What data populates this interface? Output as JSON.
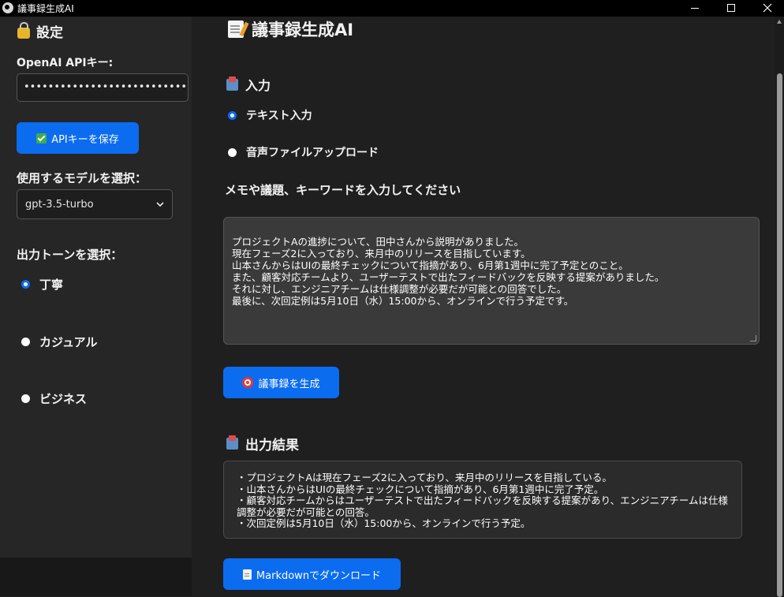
{
  "window": {
    "title": "議事録生成AI"
  },
  "sidebar": {
    "heading": "設定",
    "api_key_label": "OpenAI APIキー:",
    "api_key_value": "••••••••••••••••••••••••••••••••••••••••••••••••••",
    "save_button": "APIキーを保存",
    "model_label": "使用するモデルを選択：",
    "model_selected": "gpt-3.5-turbo",
    "tone_label": "出力トーンを選択：",
    "tone_options": [
      {
        "label": "丁寧",
        "selected": true
      },
      {
        "label": "カジュアル",
        "selected": false
      },
      {
        "label": "ビジネス",
        "selected": false
      }
    ]
  },
  "main": {
    "title": "議事録生成AI",
    "input_section": "入力",
    "input_modes": [
      {
        "label": "テキスト入力",
        "selected": true
      },
      {
        "label": "音声ファイルアップロード",
        "selected": false
      }
    ],
    "prompt_label": "メモや議題、キーワードを入力してください",
    "input_text": "プロジェクトAの進捗について、田中さんから説明がありました。\n現在フェーズ2に入っており、来月中のリリースを目指しています。\n山本さんからはUIの最終チェックについて指摘があり、6月第1週中に完了予定とのこと。\nまた、顧客対応チームより、ユーザーテストで出たフィードバックを反映する提案がありました。\nそれに対し、エンジニアチームは仕様調整が必要だが可能との回答でした。\n最後に、次回定例は5月10日（水）15:00から、オンラインで行う予定です。",
    "generate_button": "議事録を生成",
    "output_section": "出力結果",
    "output_text": "・プロジェクトAは現在フェーズ2に入っており、来月中のリリースを目指している。\n・山本さんからはUIの最終チェックについて指摘があり、6月第1週中に完了予定。\n・顧客対応チームからはユーザーテストで出たフィードバックを反映する提案があり、エンジニアチームは仕様調整が必要だが可能との回答。\n・次回定例は5月10日（水）15:00から、オンラインで行う予定。",
    "download_button": "Markdownでダウンロード"
  },
  "colors": {
    "accent": "#0b6cf0",
    "sidebar_bg": "#262626",
    "main_bg": "#1f1f1f"
  }
}
